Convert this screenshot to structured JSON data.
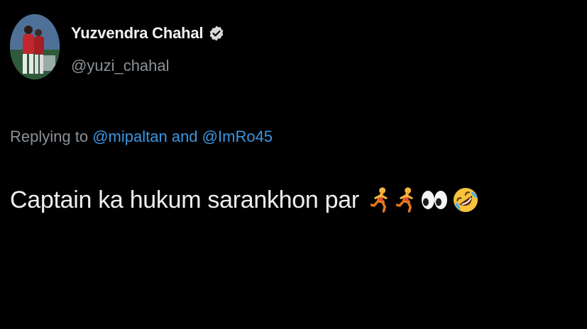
{
  "author": {
    "display_name": "Yuzvendra Chahal",
    "handle": "@yuzi_chahal",
    "verified": true
  },
  "reply": {
    "prefix": "Replying to",
    "mention_1": "@mipaltan",
    "conjunction": "and",
    "mention_2": "@ImRo45"
  },
  "tweet": {
    "text": "Captain ka hukum sarankhon par",
    "emojis": [
      "person-running-emoji",
      "person-running-emoji",
      "eyes-emoji",
      "rolling-on-floor-laughing-emoji"
    ]
  },
  "colors": {
    "background": "#000000",
    "text_primary": "#eeeeee",
    "text_secondary": "#8b9298",
    "link": "#3c96e0"
  }
}
